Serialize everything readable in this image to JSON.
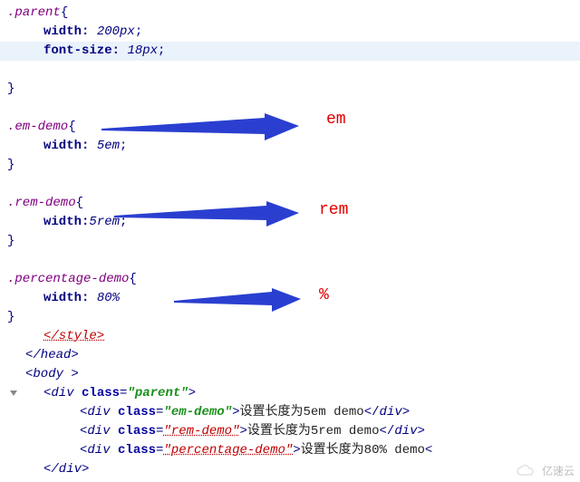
{
  "css": {
    "parent": {
      "selector": ".parent",
      "props": [
        {
          "name": "width",
          "value": "200px",
          "semi": true
        },
        {
          "name": "font-size",
          "value": "18px",
          "semi": true
        }
      ]
    },
    "em": {
      "selector": ".em-demo",
      "props": [
        {
          "name": "width",
          "value": "5em",
          "semi": true
        }
      ]
    },
    "rem": {
      "selector": ".rem-demo",
      "props": [
        {
          "name": "width",
          "value": "5rem",
          "after_colon_space": false,
          "semi": true
        }
      ]
    },
    "pct": {
      "selector": ".percentage-demo",
      "props": [
        {
          "name": "width",
          "value": "80%",
          "semi": false
        }
      ]
    }
  },
  "closing_tags": {
    "style": "</style>",
    "head": "</head>",
    "body_open": "<body >",
    "div_close": "</div>"
  },
  "html": {
    "parent_tag": "div",
    "class_attr": "class",
    "parent_class": "\"parent\"",
    "children": [
      {
        "class": "\"em-demo\"",
        "text": "设置长度为5em demo"
      },
      {
        "class": "\"rem-demo\"",
        "text": "设置长度为5rem demo"
      },
      {
        "class": "\"percentage-demo\"",
        "text": "设置长度为80% demo"
      }
    ]
  },
  "annotations": {
    "em": "em",
    "rem": "rem",
    "pct": "%"
  },
  "watermark": "亿速云"
}
